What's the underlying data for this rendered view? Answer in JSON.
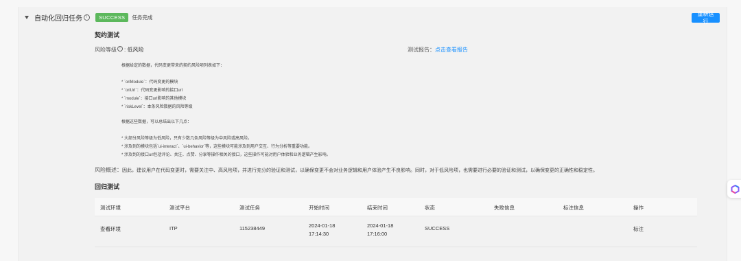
{
  "header": {
    "title": "自动化回归任务",
    "badge": "SUCCESS",
    "status_text": "任务完成",
    "rerun_label": "重新运行"
  },
  "contract": {
    "section_title": "契约测试",
    "risk_label": "风险等级",
    "risk_value": "低风险",
    "report_label": "测试报告：",
    "report_link": "点击查看报告",
    "lines": [
      "根据给定的数据，代码变更带来的契约风险项列表如下：",
      "* `oriModule`：代码变更的模块",
      "* `oriUrl`：代码变更影响的接口url",
      "* `module`：接口url影响的其他模块",
      "* `riskLevel`：本条风险数据的风险等级",
      "根据这些数据，可以总结出以下几点：",
      "* 大部分风险等级为低风险，只有少数几条风险等级为中风险或高风险。",
      "* 涉及到的模块包括`ui-interact`、`ui-behavior`等，这些模块可能涉及到用户交互、行为分析等重要功能。",
      "* 涉及到的接口url包括评论、关注、点赞、分享等操作相关的接口，这些操作可能对用户体验和业务逻辑产生影响。"
    ],
    "summary_label": "风险概述：",
    "summary_text": "因此，建议用户在代码变更时，需要关注中、高风险项，并进行充分的验证和测试，以确保变更不会对业务逻辑和用户体验产生不良影响。同时，对于低风险项，也需要进行必要的验证和测试，以确保变更的正确性和稳定性。"
  },
  "regression": {
    "section_title": "回归测试",
    "columns": [
      "测试环境",
      "测试平台",
      "测试任务",
      "开始时间",
      "结束时间",
      "状态",
      "失败信息",
      "标注信息",
      "操作"
    ],
    "row": {
      "env": "查看环境",
      "platform": "ITP",
      "task": "115238449",
      "start_date": "2024-01-18",
      "start_time": "17:14:30",
      "end_date": "2024-01-18",
      "end_time": "17:16:00",
      "status": "SUCCESS",
      "fail_info": "",
      "mark_info": "",
      "action": "标注"
    }
  },
  "colors": {
    "accent": "#1890ff",
    "success": "#5cb85c"
  },
  "icons": [
    "caret-down-icon",
    "info-icon",
    "assistant-logo-icon"
  ]
}
